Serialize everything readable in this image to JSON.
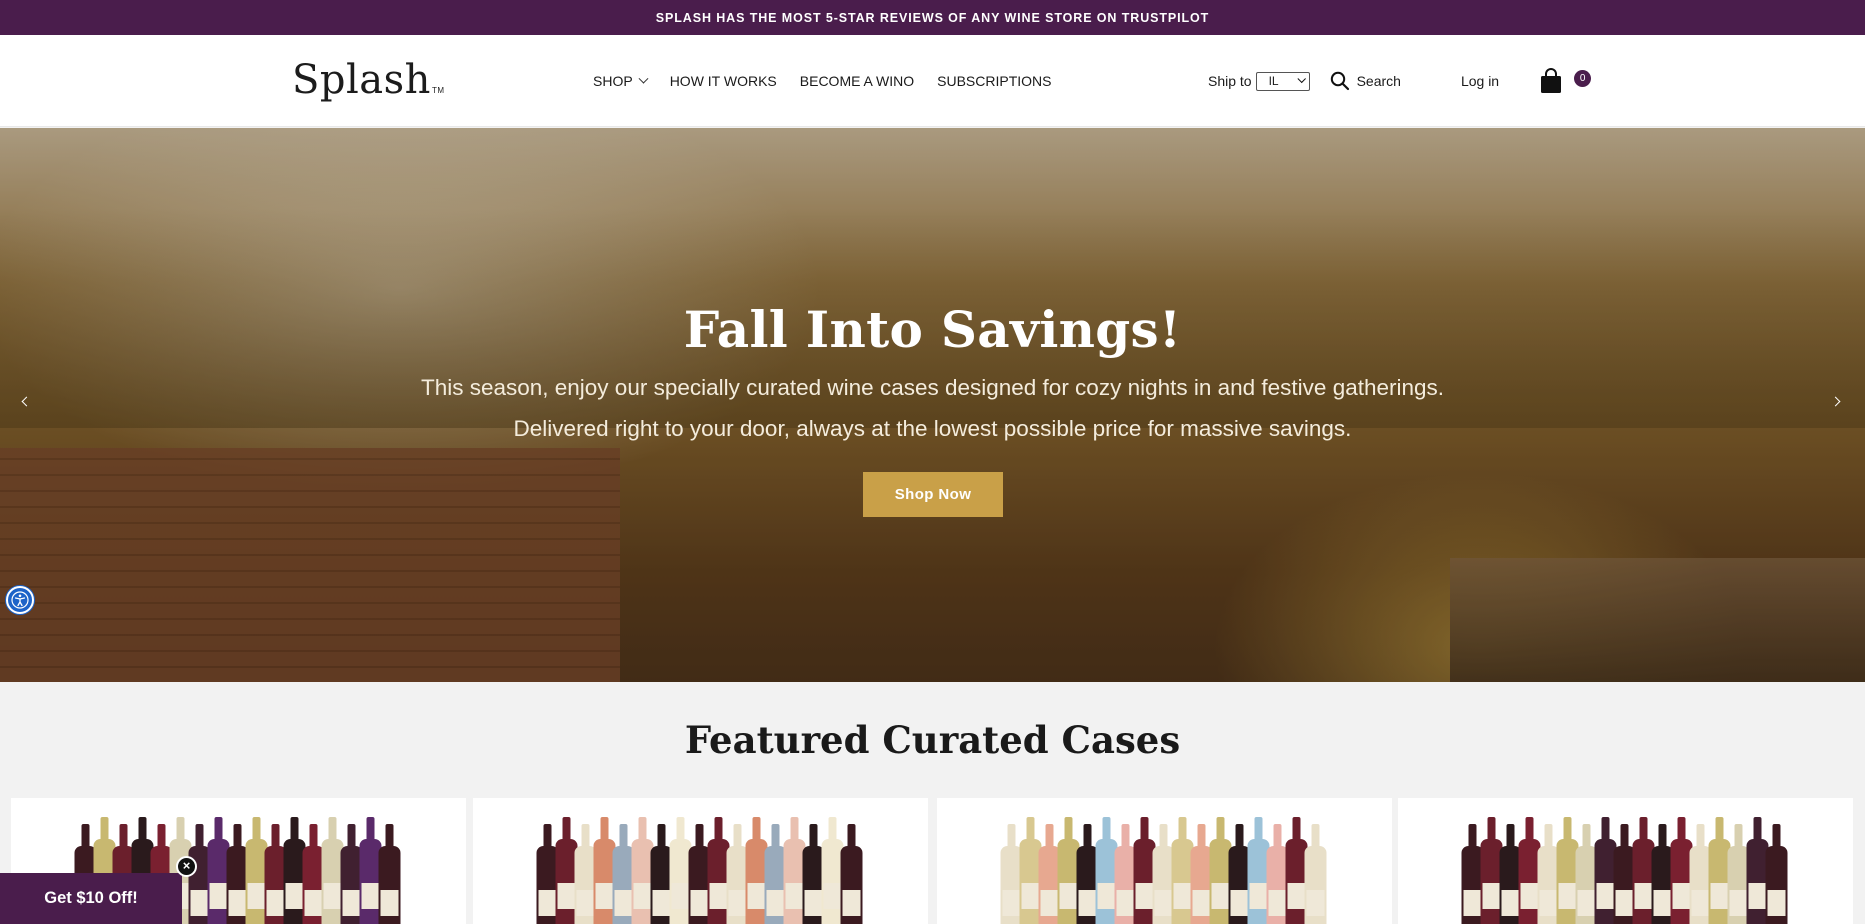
{
  "announcement": {
    "text": "SPLASH HAS THE MOST 5-STAR REVIEWS OF ANY WINE STORE ON TRUSTPILOT"
  },
  "header": {
    "logo": "Splash",
    "logo_tm": "TM",
    "nav": [
      {
        "label": "SHOP",
        "has_dropdown": true
      },
      {
        "label": "HOW IT WORKS"
      },
      {
        "label": "BECOME A WINO"
      },
      {
        "label": "SUBSCRIPTIONS"
      }
    ],
    "ship_to_label": "Ship to",
    "ship_to_value": "IL",
    "search_label": "Search",
    "login_label": "Log in",
    "cart_count": "0"
  },
  "hero": {
    "title": "Fall Into Savings!",
    "subtitle_line1": "This season, enjoy our specially curated wine cases designed for cozy nights in and festive gatherings.",
    "subtitle_line2": "Delivered right to your door, always at the lowest possible price for massive savings.",
    "cta_label": "Shop Now"
  },
  "featured": {
    "title": "Featured Curated Cases"
  },
  "promo": {
    "label": "Get $10 Off!",
    "close_glyph": "×"
  },
  "colors": {
    "brand_purple": "#4a1d4c",
    "cta_gold": "#c9a048",
    "a11y_blue": "#1d63c8"
  }
}
